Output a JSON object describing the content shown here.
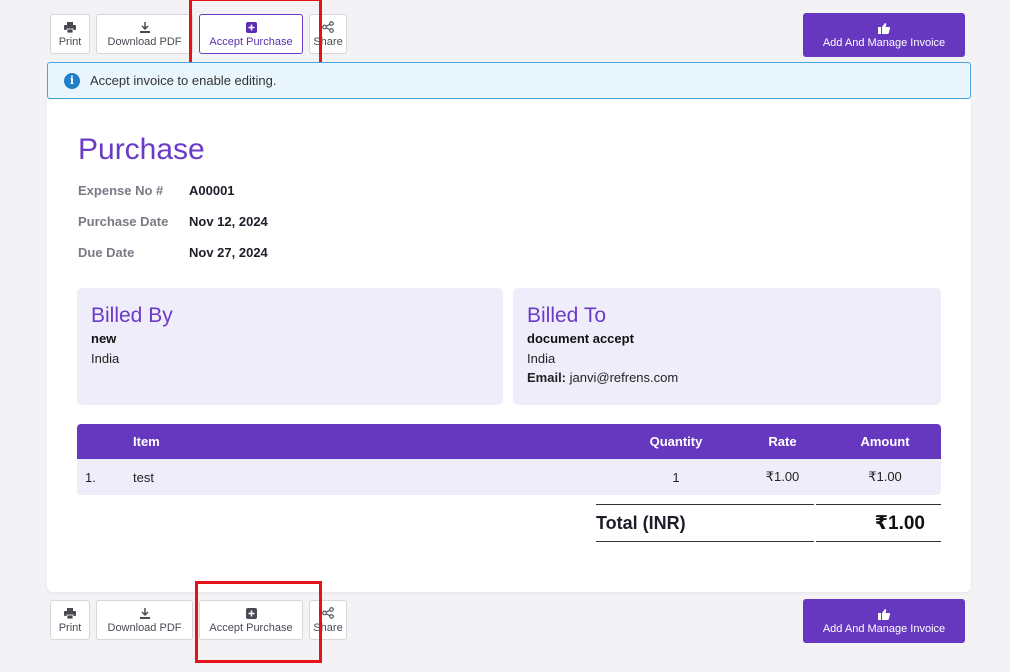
{
  "toolbar": {
    "print_label": "Print",
    "download_label": "Download PDF",
    "accept_label": "Accept Purchase",
    "share_label": "Share",
    "manage_label": "Add And Manage Invoice"
  },
  "banner": {
    "text": "Accept invoice to enable editing.",
    "icon": "info-icon"
  },
  "document": {
    "title": "Purchase",
    "meta": [
      {
        "label": "Expense No #",
        "value": "A00001"
      },
      {
        "label": "Purchase Date",
        "value": "Nov 12, 2024"
      },
      {
        "label": "Due Date",
        "value": "Nov 27, 2024"
      }
    ],
    "billed_by": {
      "heading": "Billed By",
      "name": "new",
      "country": "India"
    },
    "billed_to": {
      "heading": "Billed To",
      "name": "document accept",
      "country": "India",
      "email_label": "Email:",
      "email": "janvi@refrens.com"
    },
    "items": {
      "headers": {
        "item": "Item",
        "quantity": "Quantity",
        "rate": "Rate",
        "amount": "Amount"
      },
      "rows": [
        {
          "num": "1.",
          "item": "test",
          "quantity": "1",
          "rate": "₹1.00",
          "amount": "₹1.00"
        }
      ]
    },
    "total": {
      "label": "Total (INR)",
      "value": "₹1.00"
    }
  },
  "colors": {
    "accent": "#6638bf",
    "highlight": "#e3121b",
    "info": "#1f80c9"
  }
}
